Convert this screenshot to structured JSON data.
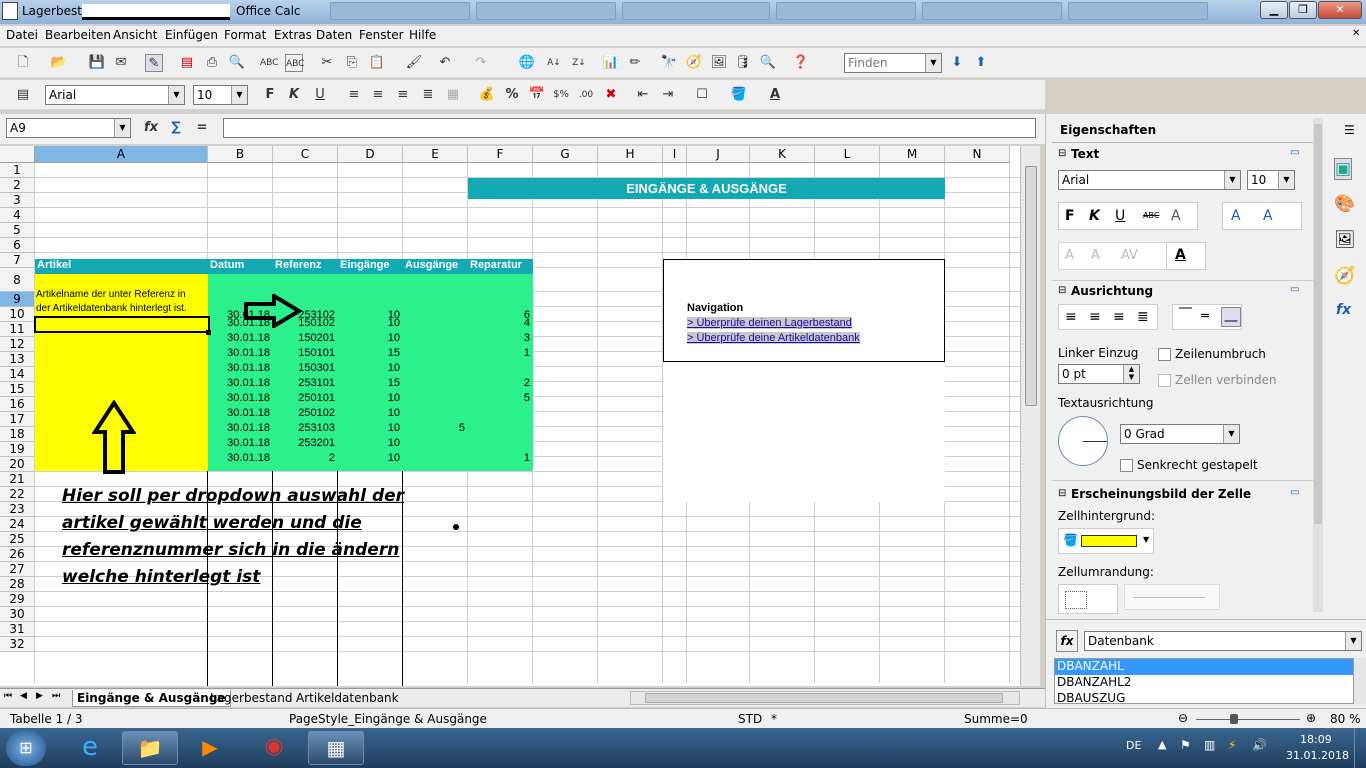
{
  "window": {
    "title_prefix": "Lagerbestand Pla",
    "title_suffix": "Office Calc",
    "btn_min": "▁",
    "btn_max": "❐",
    "btn_close": "✕"
  },
  "menu": [
    "Datei",
    "Bearbeiten",
    "Ansicht",
    "Einfügen",
    "Format",
    "Extras",
    "Daten",
    "Fenster",
    "Hilfe"
  ],
  "toolbar": {
    "find_placeholder": "Finden",
    "font_name": "Arial",
    "font_size": "10"
  },
  "formula": {
    "cell_ref": "A9",
    "value": ""
  },
  "columns": [
    "A",
    "B",
    "C",
    "D",
    "E",
    "F",
    "G",
    "H",
    "I",
    "J",
    "K",
    "L",
    "M",
    "N"
  ],
  "rows": [
    "1",
    "2",
    "3",
    "4",
    "5",
    "6",
    "7",
    "8",
    "9",
    "10",
    "11",
    "12",
    "13",
    "14",
    "15",
    "16",
    "17",
    "18",
    "19",
    "20",
    "21",
    "22",
    "23",
    "24",
    "25",
    "26",
    "27",
    "28",
    "29",
    "30",
    "31",
    "32"
  ],
  "banner": "EINGÄNGE & AUSGÄNGE",
  "table_headers": [
    "Artikel",
    "Datum",
    "Referenz",
    "Eingänge",
    "Ausgänge",
    "Reparatur"
  ],
  "a8_text_line1": "Artikelname der unter Referenz in",
  "a8_text_line2": "der Artikeldatenbank hinterlegt ist.",
  "table_rows": [
    {
      "datum": "30.01.18",
      "ref": "253102",
      "ein": "10",
      "aus": "",
      "rep": "6"
    },
    {
      "datum": "30.01.18",
      "ref": "150102",
      "ein": "10",
      "aus": "",
      "rep": "4"
    },
    {
      "datum": "30.01.18",
      "ref": "150201",
      "ein": "10",
      "aus": "",
      "rep": "3"
    },
    {
      "datum": "30.01.18",
      "ref": "150101",
      "ein": "15",
      "aus": "",
      "rep": "1"
    },
    {
      "datum": "30.01.18",
      "ref": "150301",
      "ein": "10",
      "aus": "",
      "rep": ""
    },
    {
      "datum": "30.01.18",
      "ref": "253101",
      "ein": "15",
      "aus": "",
      "rep": "2"
    },
    {
      "datum": "30.01.18",
      "ref": "250101",
      "ein": "10",
      "aus": "",
      "rep": "5"
    },
    {
      "datum": "30.01.18",
      "ref": "250102",
      "ein": "10",
      "aus": "",
      "rep": ""
    },
    {
      "datum": "30.01.18",
      "ref": "253103",
      "ein": "10",
      "aus": "5",
      "rep": ""
    },
    {
      "datum": "30.01.18",
      "ref": "253201",
      "ein": "10",
      "aus": "",
      "rep": ""
    },
    {
      "datum": "30.01.18",
      "ref": "2",
      "ein": "10",
      "aus": "",
      "rep": "1"
    }
  ],
  "navigation": {
    "title": "Navigation",
    "link1": "> Überprüfe deinen Lagerbestand",
    "link2": "> Überprüfe deine Artikeldatenbank"
  },
  "annotation": [
    "Hier soll per dropdown auswahl der",
    "artikel gewählt werden und die",
    "referenznummer sich in die ändern",
    "welche hinterlegt ist"
  ],
  "sheet_tabs": [
    "Eingänge & Ausgänge",
    "Lagerbestand",
    "Artikeldatenbank"
  ],
  "status": {
    "sheet": "Tabelle 1 / 3",
    "pagestyle": "PageStyle_Eingänge & Ausgänge",
    "mode": "STD",
    "modified": "*",
    "sum": "Summe=0",
    "zoom": "80 %"
  },
  "sidebar": {
    "title": "Eigenschaften",
    "text_section": "Text",
    "font": "Arial",
    "size": "10",
    "align_section": "Ausrichtung",
    "indent_label": "Linker Einzug",
    "indent_value": "0 pt",
    "wrap": "Zeilenumbruch",
    "merge": "Zellen verbinden",
    "orient_label": "Textausrichtung",
    "angle": "0 Grad",
    "stacked": "Senkrecht gestapelt",
    "cell_section": "Erscheinungsbild der Zelle",
    "bg_label": "Zellhintergrund:",
    "border_label": "Zellumrandung:",
    "cell_bg_color": "#ffff00",
    "func_category": "Datenbank",
    "functions": [
      "DBANZAHL",
      "DBANZAHL2",
      "DBAUSZUG"
    ]
  },
  "taskbar": {
    "lang": "DE",
    "time": "18:09",
    "date": "31.01.2018"
  }
}
